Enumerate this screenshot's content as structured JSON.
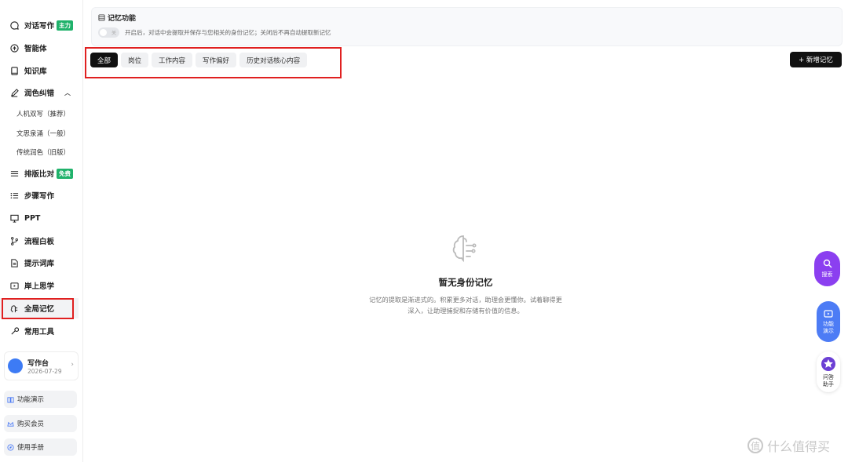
{
  "sidebar": {
    "items": [
      {
        "label": "对话写作",
        "badge": "主力"
      },
      {
        "label": "智能体"
      },
      {
        "label": "知识库"
      },
      {
        "label": "润色纠错"
      },
      {
        "label": "排版比对",
        "badge": "免费"
      },
      {
        "label": "步骤写作"
      },
      {
        "label": "PPT"
      },
      {
        "label": "流程白板"
      },
      {
        "label": "提示词库"
      },
      {
        "label": "岸上思学"
      },
      {
        "label": "全局记忆"
      },
      {
        "label": "常用工具"
      }
    ],
    "sub_items": [
      "人机双写（推荐）",
      "文思泉涌（一般）",
      "传统润色（旧版）"
    ],
    "profile": {
      "name": "写作台",
      "date": "2026-07-29"
    },
    "bottom": [
      "功能演示",
      "购买会员",
      "使用手册"
    ]
  },
  "memory": {
    "title": "记忆功能",
    "toggle_label": "关",
    "description": "开启后，对话中会提取并保存与您相关的身份记忆；关闭后不再自动提取新记忆"
  },
  "tabs": [
    "全部",
    "岗位",
    "工作内容",
    "写作偏好",
    "历史对话核心内容"
  ],
  "add_button": "+ 新增记忆",
  "empty": {
    "title": "暂无身份记忆",
    "desc": "记忆的提取是渐进式的。积累更多对话，助理会更懂你。试着聊得更深入，让助理捕捉和存储有价值的信息。"
  },
  "floating": {
    "search": "搜索",
    "demo": "功能演示",
    "qa": "问答助手"
  },
  "watermark": "什么值得买",
  "colors": {
    "accent_red": "#e02020",
    "badge_green": "#20b26b",
    "purple": "#8b3ff0",
    "blue": "#4d7cf5"
  }
}
